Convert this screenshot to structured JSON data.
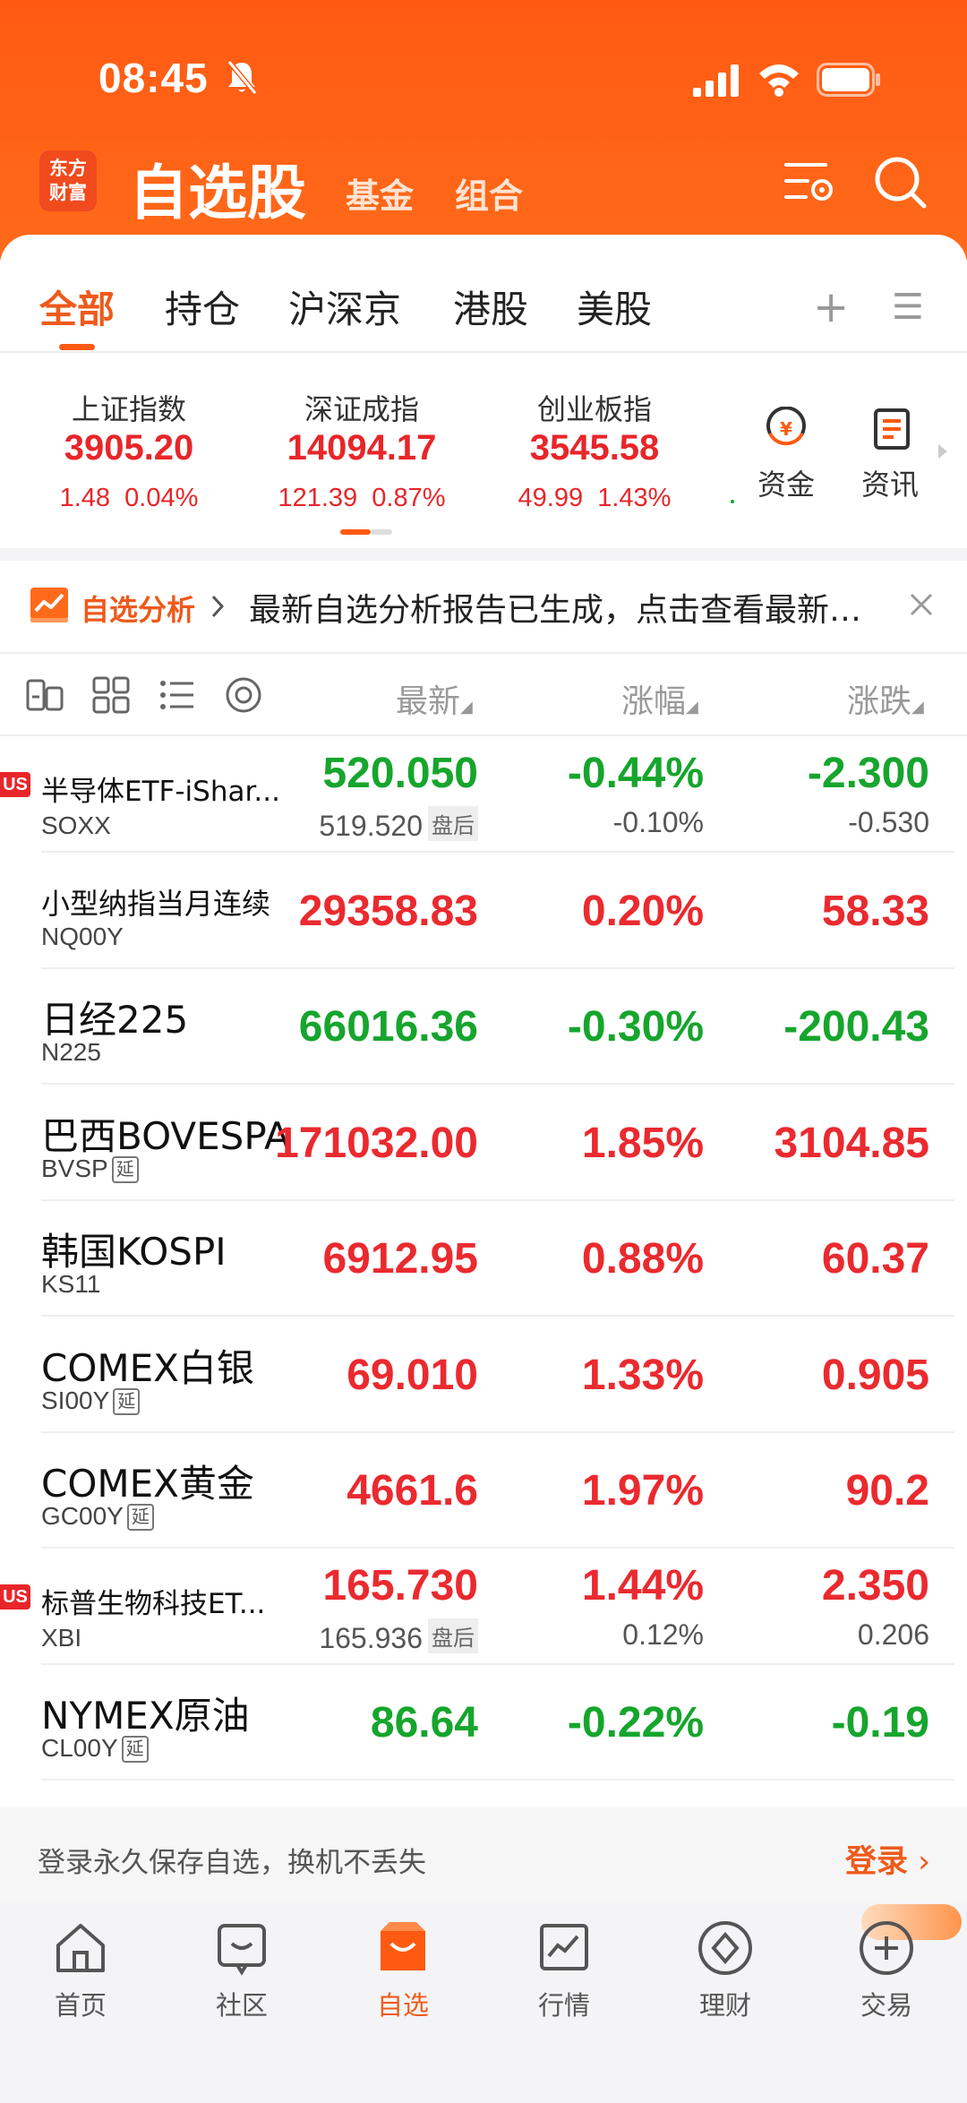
{
  "status_bar": {
    "time": "08:45"
  },
  "header": {
    "logo_line1": "东方",
    "logo_line2": "财富",
    "title": "自选股",
    "tabs": [
      "基金",
      "组合"
    ]
  },
  "watch_tabs": {
    "items": [
      "全部",
      "持仓",
      "沪深京",
      "港股",
      "美股"
    ],
    "active_index": 0,
    "add_symbol": "+",
    "menu_symbol": "☰"
  },
  "indices": [
    {
      "name": "上证指数",
      "value": "3905.20",
      "change": "1.48",
      "percent": "0.04%"
    },
    {
      "name": "深证成指",
      "value": "14094.17",
      "change": "121.39",
      "percent": "0.87%"
    },
    {
      "name": "创业板指",
      "value": "3545.58",
      "change": "49.99",
      "percent": "1.43%"
    }
  ],
  "quick_links": {
    "funds": "资金",
    "news": "资讯"
  },
  "banner": {
    "label": "自选分析",
    "text": "最新自选分析报告已生成，点击查看最新…"
  },
  "columns": {
    "latest": "最新",
    "change_pct": "涨幅",
    "change": "涨跌"
  },
  "rows": [
    {
      "name": "半导体ETF-iShar...",
      "code": "SOXX",
      "us": true,
      "delayed": false,
      "price": "520.050",
      "pct": "-0.44%",
      "chg": "-2.300",
      "color": "green",
      "post_price": "519.520",
      "post_tag": "盘后",
      "post_pct": "-0.10%",
      "post_chg": "-0.530"
    },
    {
      "name": "小型纳指当月连续",
      "code": "NQ00Y",
      "us": false,
      "delayed": false,
      "price": "29358.83",
      "pct": "0.20%",
      "chg": "58.33",
      "color": "red"
    },
    {
      "name": "日经225",
      "code": "N225",
      "us": false,
      "delayed": false,
      "price": "66016.36",
      "pct": "-0.30%",
      "chg": "-200.43",
      "color": "green"
    },
    {
      "name": "巴西BOVESPA",
      "code": "BVSP",
      "us": false,
      "delayed": true,
      "price": "171032.00",
      "pct": "1.85%",
      "chg": "3104.85",
      "color": "red"
    },
    {
      "name": "韩国KOSPI",
      "code": "KS11",
      "us": false,
      "delayed": false,
      "price": "6912.95",
      "pct": "0.88%",
      "chg": "60.37",
      "color": "red"
    },
    {
      "name": "COMEX白银",
      "code": "SI00Y",
      "us": false,
      "delayed": true,
      "price": "69.010",
      "pct": "1.33%",
      "chg": "0.905",
      "color": "red"
    },
    {
      "name": "COMEX黄金",
      "code": "GC00Y",
      "us": false,
      "delayed": true,
      "price": "4661.6",
      "pct": "1.97%",
      "chg": "90.2",
      "color": "red"
    },
    {
      "name": "标普生物科技ET...",
      "code": "XBI",
      "us": true,
      "delayed": false,
      "price": "165.730",
      "pct": "1.44%",
      "chg": "2.350",
      "color": "red",
      "post_price": "165.936",
      "post_tag": "盘后",
      "post_pct": "0.12%",
      "post_chg": "0.206"
    },
    {
      "name": "NYMEX原油",
      "code": "CL00Y",
      "us": false,
      "delayed": true,
      "price": "86.64",
      "pct": "-0.22%",
      "chg": "-0.19",
      "color": "green"
    }
  ],
  "us_badge": "US",
  "delay_tag": "延",
  "login_bar": {
    "text": "登录永久保存自选，换机不丢失",
    "button": "登录"
  },
  "bottom_nav": [
    {
      "label": "首页",
      "icon": "home-icon"
    },
    {
      "label": "社区",
      "icon": "chat-icon"
    },
    {
      "label": "自选",
      "icon": "watchlist-icon",
      "active": true
    },
    {
      "label": "行情",
      "icon": "chart-icon"
    },
    {
      "label": "理财",
      "icon": "diamond-icon"
    },
    {
      "label": "交易",
      "icon": "trade-icon"
    }
  ],
  "colors": {
    "brand": "#ff5a12",
    "up": "#ea2a2f",
    "down": "#16a52d"
  }
}
